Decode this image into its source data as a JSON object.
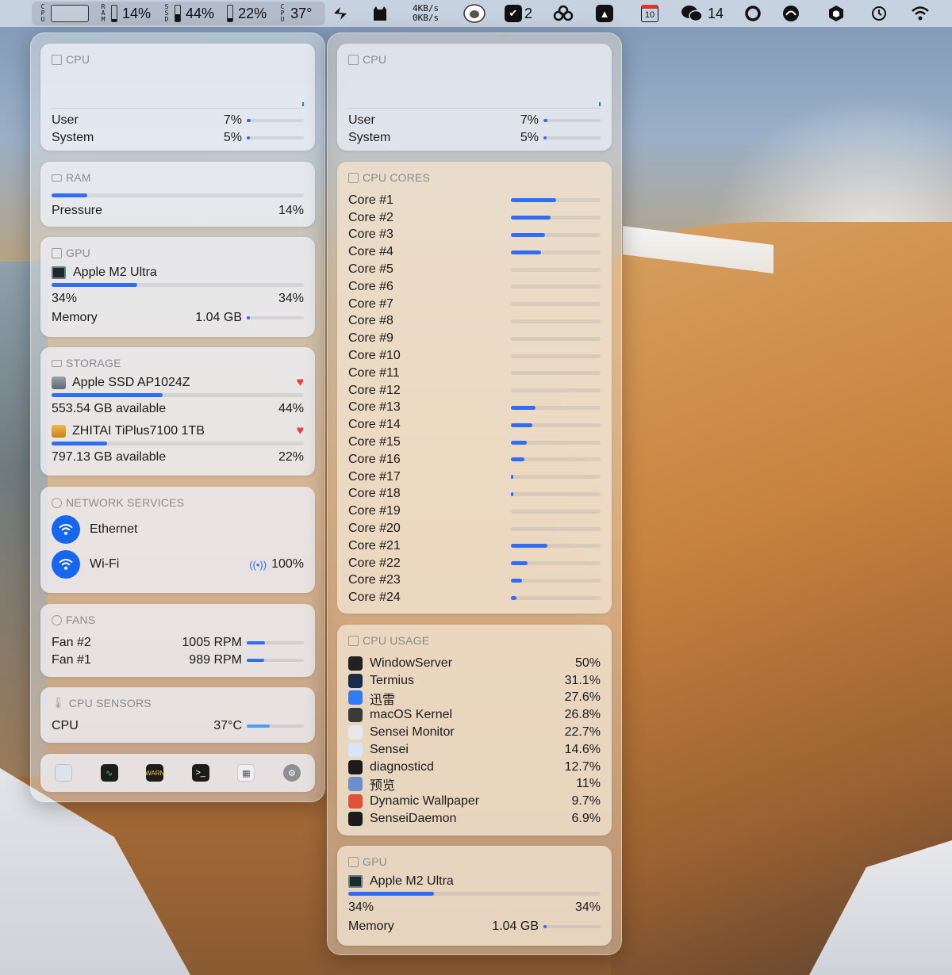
{
  "menubar": {
    "cpu_label": "CPU",
    "ram_label": "RAM",
    "ram_value": "14%",
    "ram_fill": 0.14,
    "ssd_label": "SSD",
    "ssd1_value": "44%",
    "ssd1_fill": 0.44,
    "ssd2_value": "22%",
    "ssd2_fill": 0.22,
    "cpu_temp_label": "CPU",
    "cpu_temp_value": "37°",
    "net_up": "4KB/s",
    "net_down": "0KB/s",
    "kanban_count": "2",
    "calendar_day": "10",
    "wechat_count": "14"
  },
  "left": {
    "cpu": {
      "title": "CPU",
      "rows": [
        {
          "label": "User",
          "value": "7%",
          "fill": 0.07
        },
        {
          "label": "System",
          "value": "5%",
          "fill": 0.05
        }
      ]
    },
    "ram": {
      "title": "RAM",
      "fill": 0.14,
      "label": "Pressure",
      "value": "14%"
    },
    "gpu": {
      "title": "GPU",
      "name": "Apple M2 Ultra",
      "fill": 0.34,
      "usage_left": "34%",
      "usage_right": "34%",
      "memory_label": "Memory",
      "memory_value": "1.04 GB",
      "memory_fill": 0.02
    },
    "storage": {
      "title": "STORAGE",
      "disks": [
        {
          "name": "Apple SSD AP1024Z",
          "fill": 0.44,
          "available": "553.54 GB available",
          "percent": "44%"
        },
        {
          "name": "ZHITAI TiPlus7100 1TB",
          "fill": 0.22,
          "available": "797.13 GB available",
          "percent": "22%"
        }
      ]
    },
    "network": {
      "title": "NETWORK SERVICES",
      "services": [
        {
          "name": "Ethernet",
          "value": ""
        },
        {
          "name": "Wi-Fi",
          "value": "100%"
        }
      ]
    },
    "fans": {
      "title": "FANS",
      "rows": [
        {
          "label": "Fan #2",
          "value": "1005 RPM",
          "fill": 0.32
        },
        {
          "label": "Fan #1",
          "value": "989 RPM",
          "fill": 0.31
        }
      ]
    },
    "sensors": {
      "title": "CPU SENSORS",
      "label": "CPU",
      "value": "37°C",
      "fill": 0.4
    }
  },
  "right": {
    "cpu": {
      "title": "CPU",
      "rows": [
        {
          "label": "User",
          "value": "7%",
          "fill": 0.07
        },
        {
          "label": "System",
          "value": "5%",
          "fill": 0.05
        }
      ]
    },
    "cores": {
      "title": "CPU CORES",
      "items": [
        {
          "label": "Core #1",
          "fill": 0.5
        },
        {
          "label": "Core #2",
          "fill": 0.44
        },
        {
          "label": "Core #3",
          "fill": 0.38
        },
        {
          "label": "Core #4",
          "fill": 0.34
        },
        {
          "label": "Core #5",
          "fill": 0
        },
        {
          "label": "Core #6",
          "fill": 0
        },
        {
          "label": "Core #7",
          "fill": 0
        },
        {
          "label": "Core #8",
          "fill": 0
        },
        {
          "label": "Core #9",
          "fill": 0
        },
        {
          "label": "Core #10",
          "fill": 0
        },
        {
          "label": "Core #11",
          "fill": 0
        },
        {
          "label": "Core #12",
          "fill": 0
        },
        {
          "label": "Core #13",
          "fill": 0.27
        },
        {
          "label": "Core #14",
          "fill": 0.24
        },
        {
          "label": "Core #15",
          "fill": 0.18
        },
        {
          "label": "Core #16",
          "fill": 0.15
        },
        {
          "label": "Core #17",
          "fill": 0.03
        },
        {
          "label": "Core #18",
          "fill": 0.03
        },
        {
          "label": "Core #19",
          "fill": 0
        },
        {
          "label": "Core #20",
          "fill": 0
        },
        {
          "label": "Core #21",
          "fill": 0.41
        },
        {
          "label": "Core #22",
          "fill": 0.19
        },
        {
          "label": "Core #23",
          "fill": 0.12
        },
        {
          "label": "Core #24",
          "fill": 0.06
        }
      ]
    },
    "usage": {
      "title": "CPU USAGE",
      "items": [
        {
          "name": "WindowServer",
          "value": "50%",
          "color": "#222222"
        },
        {
          "name": "Termius",
          "value": "31.1%",
          "color": "#1d2b4a"
        },
        {
          "name": "迅雷",
          "value": "27.6%",
          "color": "#2f7cf6"
        },
        {
          "name": "macOS Kernel",
          "value": "26.8%",
          "color": "#3a3a3a"
        },
        {
          "name": "Sensei Monitor",
          "value": "22.7%",
          "color": "#e8e8ec"
        },
        {
          "name": "Sensei",
          "value": "14.6%",
          "color": "#d8e6fb"
        },
        {
          "name": "diagnosticd",
          "value": "12.7%",
          "color": "#1c1c1c"
        },
        {
          "name": "预览",
          "value": "11%",
          "color": "#6d8fc9"
        },
        {
          "name": "Dynamic Wallpaper",
          "value": "9.7%",
          "color": "#e0533a"
        },
        {
          "name": "SenseiDaemon",
          "value": "6.9%",
          "color": "#1c1c1c"
        }
      ]
    },
    "gpu": {
      "title": "GPU",
      "name": "Apple M2 Ultra",
      "fill": 0.34,
      "usage_left": "34%",
      "usage_right": "34%",
      "memory_label": "Memory",
      "memory_value": "1.04 GB",
      "memory_fill": 0.02
    }
  },
  "colors": {
    "accent": "#2f6df6",
    "network_circle": "#1766f0",
    "heart": "#f23a3a"
  },
  "dock_icons": [
    "sensei-app-icon",
    "activity-monitor-icon",
    "console-icon",
    "terminal-icon",
    "system-information-icon",
    "system-settings-icon"
  ]
}
